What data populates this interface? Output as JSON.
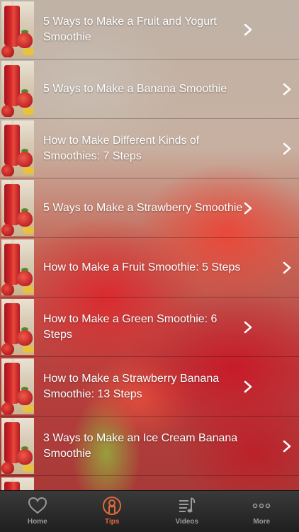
{
  "items": [
    {
      "title": "5 Ways to Make a Fruit and Yogurt Smoothie"
    },
    {
      "title": "5 Ways to Make a Banana Smoothie"
    },
    {
      "title": "How to Make Different Kinds of Smoothies: 7 Steps"
    },
    {
      "title": "5 Ways to Make a Strawberry Smoothie"
    },
    {
      "title": "How to Make a Fruit Smoothie: 5 Steps"
    },
    {
      "title": "How to Make a Green Smoothie: 6 Steps"
    },
    {
      "title": "How to Make a Strawberry Banana Smoothie: 13 Steps"
    },
    {
      "title": "3 Ways to Make an Ice Cream Banana Smoothie"
    }
  ],
  "tabbar": {
    "tabs": [
      {
        "label": "Home",
        "icon": "heart-icon",
        "active": false
      },
      {
        "label": "Tips",
        "icon": "person-circle-icon",
        "active": true
      },
      {
        "label": "Videos",
        "icon": "music-list-icon",
        "active": false
      },
      {
        "label": "More",
        "icon": "more-dots-icon",
        "active": false
      }
    ],
    "active_color": "#e06a3a",
    "inactive_color": "#9a9a9a"
  }
}
